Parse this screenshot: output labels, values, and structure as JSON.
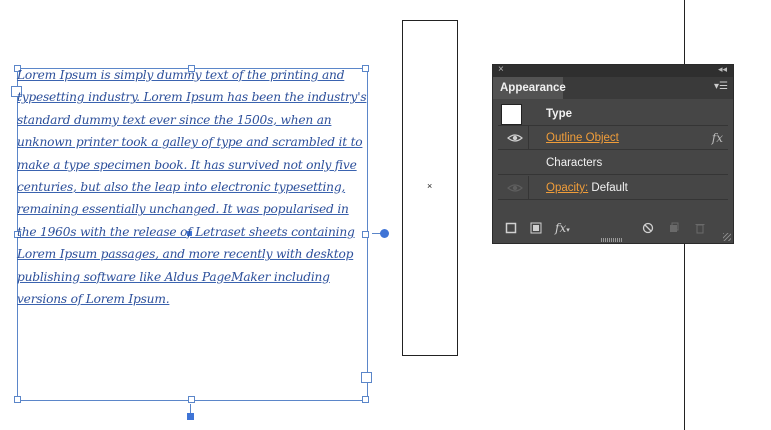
{
  "canvas": {
    "body_text": "Lorem Ipsum is simply dummy text of the printing and typesetting industry. Lorem Ipsum has been the industry's standard dummy text ever since the 1500s, when an unknown printer took a galley of type and scrambled it to make a type specimen book. It has survived not only five centuries, but also the leap into electronic typesetting, remaining essentially unchanged. It was popularised in the 1960s with the release of Letraset sheets containing Lorem Ipsum passages, and more recently with desktop publishing software like Aldus PageMaker including versions of Lorem Ipsum.",
    "rect_center_mark": "×"
  },
  "panel": {
    "close_glyph": "×",
    "collapse_glyph": "◂◂",
    "tab_label": "Appearance",
    "menu_glyph": "▾☰",
    "rows": [
      {
        "label": "Type"
      },
      {
        "label": "Outline Object",
        "fx": "fx"
      },
      {
        "label": "Characters"
      },
      {
        "label_link": "Opacity:",
        "value": " Default"
      }
    ],
    "bottom_icons": [
      "add-new-stroke-icon",
      "add-new-fill-icon",
      "add-new-effect-icon",
      "clear-appearance-icon",
      "duplicate-item-icon",
      "delete-item-icon"
    ],
    "fx_label": "fx",
    "fx_caret": "▾",
    "colors": {
      "panel_bg": "#464646",
      "link": "#f09d3a",
      "selection": "#3f74d6"
    }
  }
}
